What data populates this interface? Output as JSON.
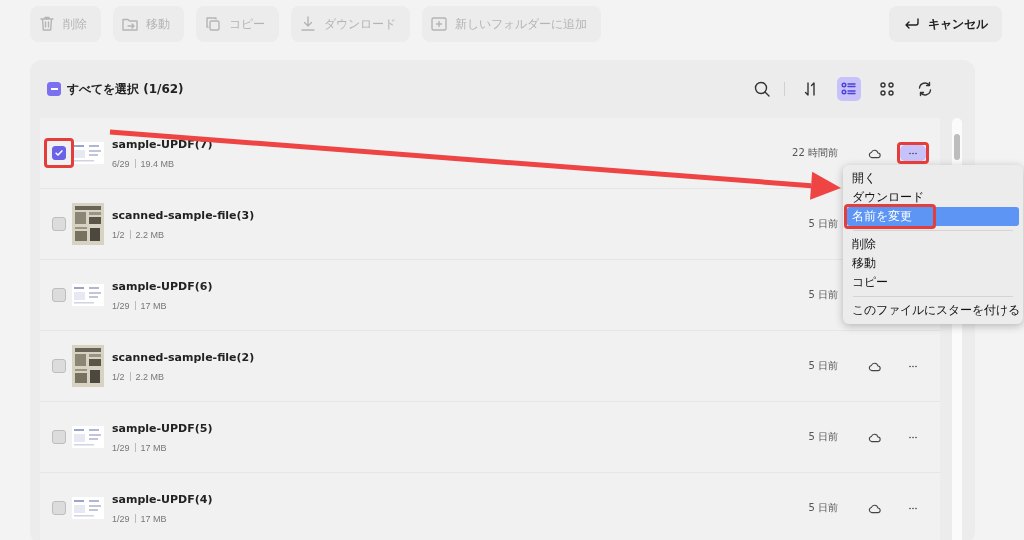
{
  "toolbar": [
    {
      "kind": "delete",
      "label": "削除",
      "disabled": true
    },
    {
      "kind": "move",
      "label": "移動",
      "disabled": true
    },
    {
      "kind": "copy",
      "label": "コピー",
      "disabled": true
    },
    {
      "kind": "download",
      "label": "ダウンロード",
      "disabled": true
    },
    {
      "kind": "folder",
      "label": "新しいフォルダーに追加",
      "disabled": true
    }
  ],
  "cancel_button": {
    "label": "キャンセル"
  },
  "header": {
    "select_all": {
      "label": "すべてを選択 (1/62)",
      "indeterminate": true
    },
    "tools": [
      {
        "kind": "search",
        "selected": false
      },
      {
        "kind": "sort",
        "selected": false
      },
      {
        "kind": "list",
        "selected": true
      },
      {
        "kind": "grid",
        "selected": false
      },
      {
        "kind": "refresh",
        "selected": false
      }
    ]
  },
  "files": [
    {
      "name": "sample-UPDF(7)",
      "pages": "6/29",
      "size": "19.4 MB",
      "time": "22 時間前",
      "kind": "document",
      "checked": true,
      "actions": true,
      "menu_open": true,
      "checkbox_highlighted": true,
      "more_highlighted": true
    },
    {
      "name": "scanned-sample-file(3)",
      "pages": "1/2",
      "size": "2.2 MB",
      "time": "5 日前",
      "kind": "scan",
      "checked": false,
      "checkbox_highlighted": false
    },
    {
      "name": "sample-UPDF(6)",
      "pages": "1/29",
      "size": "17 MB",
      "time": "5 日前",
      "kind": "document",
      "checked": false,
      "checkbox_highlighted": false
    },
    {
      "name": "scanned-sample-file(2)",
      "pages": "1/2",
      "size": "2.2 MB",
      "time": "5 日前",
      "kind": "scan",
      "checked": false,
      "actions": true,
      "menu_open": false,
      "checkbox_highlighted": false,
      "more_highlighted": false
    },
    {
      "name": "sample-UPDF(5)",
      "pages": "1/29",
      "size": "17 MB",
      "time": "5 日前",
      "kind": "document",
      "checked": false,
      "actions": true,
      "menu_open": false,
      "checkbox_highlighted": false,
      "more_highlighted": false
    },
    {
      "name": "sample-UPDF(4)",
      "pages": "1/29",
      "size": "17 MB",
      "time": "5 日前",
      "kind": "document",
      "checked": false,
      "actions": true,
      "menu_open": false,
      "checkbox_highlighted": false,
      "more_highlighted": false
    }
  ],
  "context_menu": {
    "groups": [
      [
        {
          "label": "開く",
          "selected": false,
          "highlighted": false
        },
        {
          "label": "ダウンロード",
          "selected": false,
          "highlighted": false
        },
        {
          "label": "名前を変更",
          "selected": true,
          "highlighted": true
        }
      ],
      [
        {
          "label": "削除",
          "selected": false,
          "highlighted": false
        },
        {
          "label": "移動",
          "selected": false,
          "highlighted": false
        },
        {
          "label": "コピー",
          "selected": false,
          "highlighted": false
        }
      ],
      [
        {
          "label": "このファイルにスターを付ける",
          "selected": false,
          "highlighted": false
        }
      ]
    ]
  },
  "pointer_arrow": true
}
